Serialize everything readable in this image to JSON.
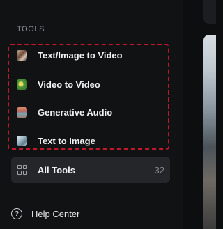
{
  "section": {
    "label": "TOOLS"
  },
  "tools": [
    {
      "label": "Text/Image to Video",
      "icon": "text-image-to-video-thumbnail"
    },
    {
      "label": "Video to Video",
      "icon": "video-to-video-thumbnail"
    },
    {
      "label": "Generative Audio",
      "icon": "generative-audio-thumbnail"
    },
    {
      "label": "Text to Image",
      "icon": "text-to-image-thumbnail"
    }
  ],
  "all_tools": {
    "label": "All Tools",
    "count": "32",
    "icon": "grid-icon"
  },
  "help": {
    "label": "Help Center",
    "icon": "help-circle-icon"
  },
  "colors": {
    "highlight_border": "#c0182a",
    "sidebar_bg": "#111214",
    "button_bg": "#24262a"
  }
}
